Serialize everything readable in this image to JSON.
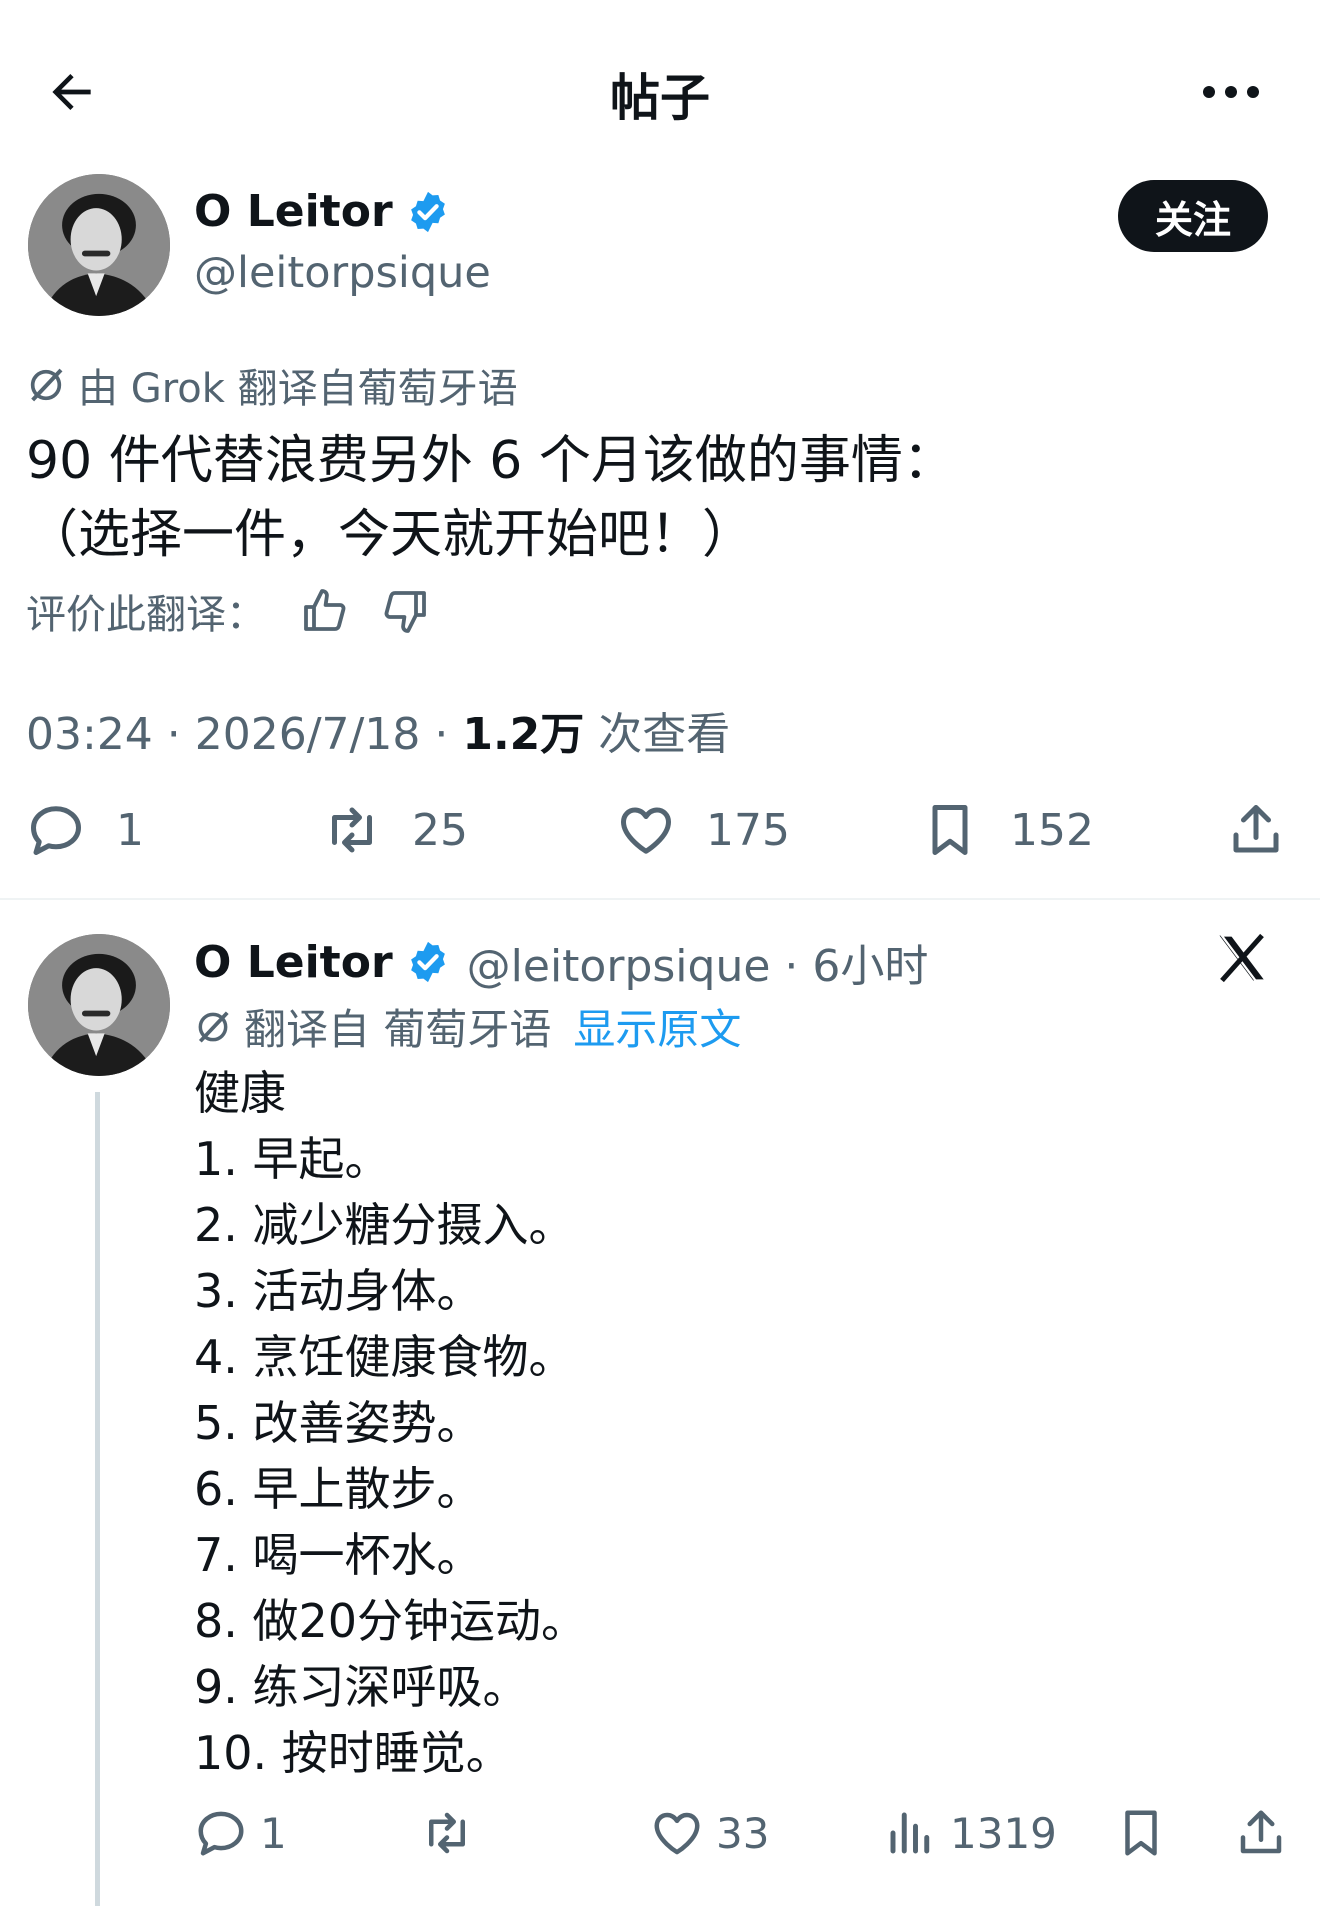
{
  "nav": {
    "title": "帖子"
  },
  "post": {
    "author_name": "O Leitor",
    "author_handle": "@leitorpsique",
    "follow_label": "关注",
    "translation_note": "由 Grok 翻译自葡萄牙语",
    "text_lines": [
      "90 件代替浪费另外 6 个月该做的事情：",
      "（选择一件，今天就开始吧！）"
    ],
    "rate_label": "评价此翻译：",
    "meta_time": "03:24 · 2026/7/18 · ",
    "meta_views_count": "1.2万",
    "meta_views_label": " 次查看",
    "stats": {
      "replies": "1",
      "reposts": "25",
      "likes": "175",
      "bookmarks": "152"
    }
  },
  "reply": {
    "author_name": "O Leitor",
    "author_handle": "@leitorpsique · 6小时",
    "translation_note": "翻译自 葡萄牙语",
    "show_original": "显示原文",
    "lines": [
      "健康",
      "1. 早起。",
      "2. 减少糖分摄入。",
      "3. 活动身体。",
      "4. 烹饪健康食物。",
      "5. 改善姿势。",
      "6. 早上散步。",
      "7. 喝一杯水。",
      "8. 做20分钟运动。",
      "9. 练习深呼吸。",
      "10. 按时睡觉。"
    ],
    "stats": {
      "replies": "1",
      "likes": "33",
      "views": "1319"
    }
  },
  "colors": {
    "text": "#0f1419",
    "secondary": "#536471",
    "accent": "#1d9bf0",
    "verified": "#1d9bf0"
  },
  "icons": [
    "back-arrow-icon",
    "more-icon",
    "verified-badge-icon",
    "grok-icon",
    "thumbs-up-icon",
    "thumbs-down-icon",
    "reply-icon",
    "repost-icon",
    "like-icon",
    "bookmark-icon",
    "share-icon",
    "views-icon",
    "x-logo-icon"
  ]
}
